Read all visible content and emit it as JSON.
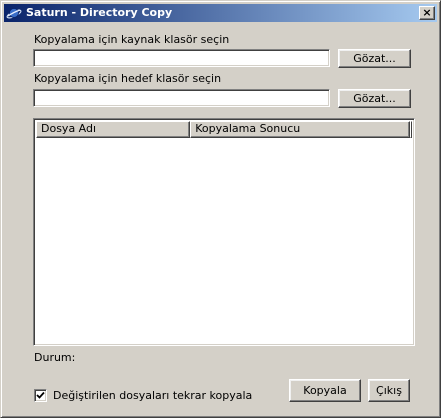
{
  "window": {
    "title": "Saturn - Directory Copy",
    "close_glyph": "×"
  },
  "source": {
    "label": "Kopyalama için kaynak klasör seçin",
    "value": "",
    "browse_label": "Gözat..."
  },
  "target": {
    "label": "Kopyalama için hedef klasör seçin",
    "value": "",
    "browse_label": "Gözat..."
  },
  "list": {
    "columns": [
      "Dosya Adı",
      "Kopyalama Sonucu"
    ]
  },
  "status": {
    "label": "Durum:"
  },
  "options": {
    "recopy_label": "Değiştirilen dosyaları tekrar kopyala",
    "recopy_checked": true
  },
  "actions": {
    "copy_label": "Kopyala",
    "exit_label": "Çıkış"
  },
  "icons": {
    "app": "saturn-planet-icon",
    "close": "close-icon",
    "check": "checkmark-icon"
  },
  "colors": {
    "title_gradient_start": "#0a246a",
    "title_gradient_end": "#a6caf0",
    "face": "#d4d0c8"
  }
}
